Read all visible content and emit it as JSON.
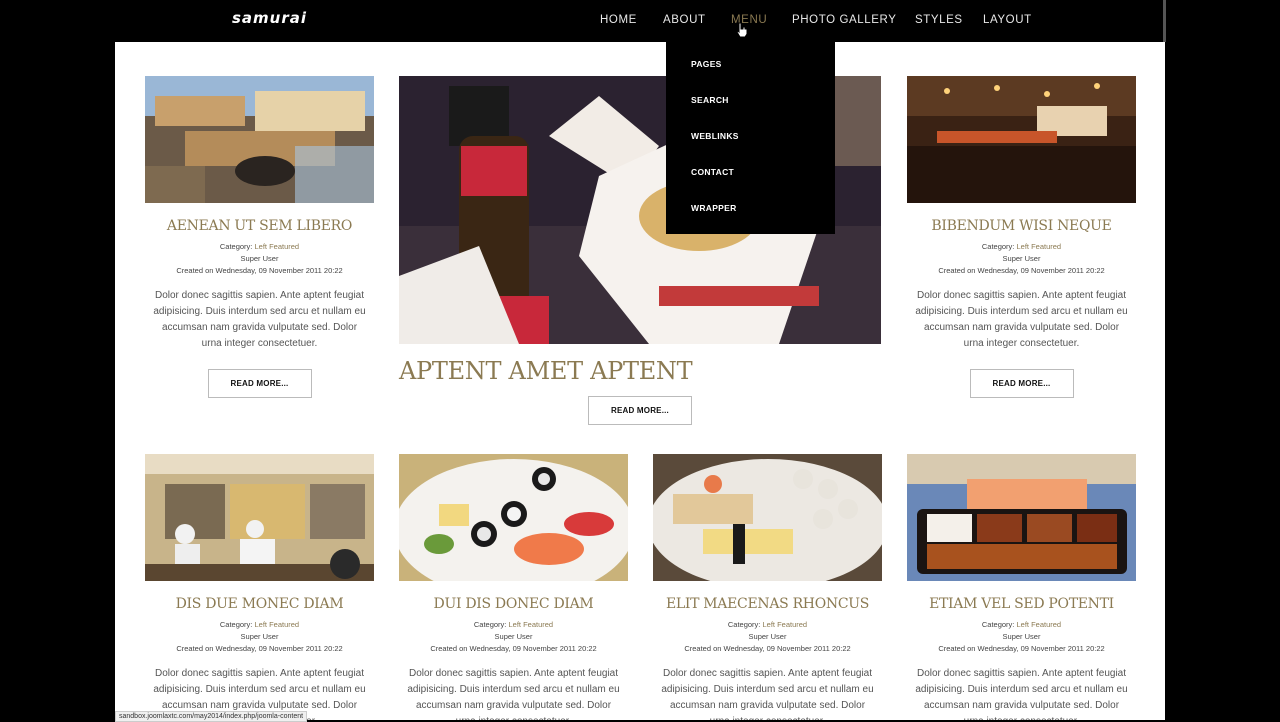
{
  "site": {
    "logo": "samurai"
  },
  "nav": {
    "items": [
      {
        "label": "HOME"
      },
      {
        "label": "ABOUT"
      },
      {
        "label": "MENU"
      },
      {
        "label": "PHOTO GALLERY"
      },
      {
        "label": "STYLES"
      },
      {
        "label": "LAYOUT"
      }
    ],
    "active": "MENU"
  },
  "dropdown": {
    "items": [
      {
        "label": "PAGES"
      },
      {
        "label": "SEARCH"
      },
      {
        "label": "WEBLINKS"
      },
      {
        "label": "CONTACT"
      },
      {
        "label": "WRAPPER"
      }
    ]
  },
  "common": {
    "category_prefix": "Category: ",
    "category": "Left Featured",
    "author": "Super User",
    "created": "Created on Wednesday, 09 November 2011 20:22",
    "body": "Dolor donec sagittis sapien. Ante aptent feugiat adipisicing. Duis interdum sed arcu et nullam eu accumsan nam gravida vulputate sed. Dolor urna integer consectetuer.",
    "read_more": "READ MORE..."
  },
  "featured": {
    "title": "APTENT AMET APTENT",
    "read_more": "READ MORE..."
  },
  "articles": [
    {
      "title": "AENEAN UT SEM LIBERO"
    },
    {
      "title": "BIBENDUM WISI NEQUE"
    },
    {
      "title": "DIS DUE MONEC DIAM"
    },
    {
      "title": "DUI DIS DONEC DIAM"
    },
    {
      "title": "ELIT MAECENAS RHONCUS"
    },
    {
      "title": "ETIAM VEL SED POTENTI"
    }
  ],
  "status_bar": {
    "url": "sandbox.joomlaxtc.com/may2014/index.php/joomla-content"
  },
  "colors": {
    "accent": "#8b7a52",
    "nav_bg": "#000000",
    "page_bg": "#ffffff"
  }
}
